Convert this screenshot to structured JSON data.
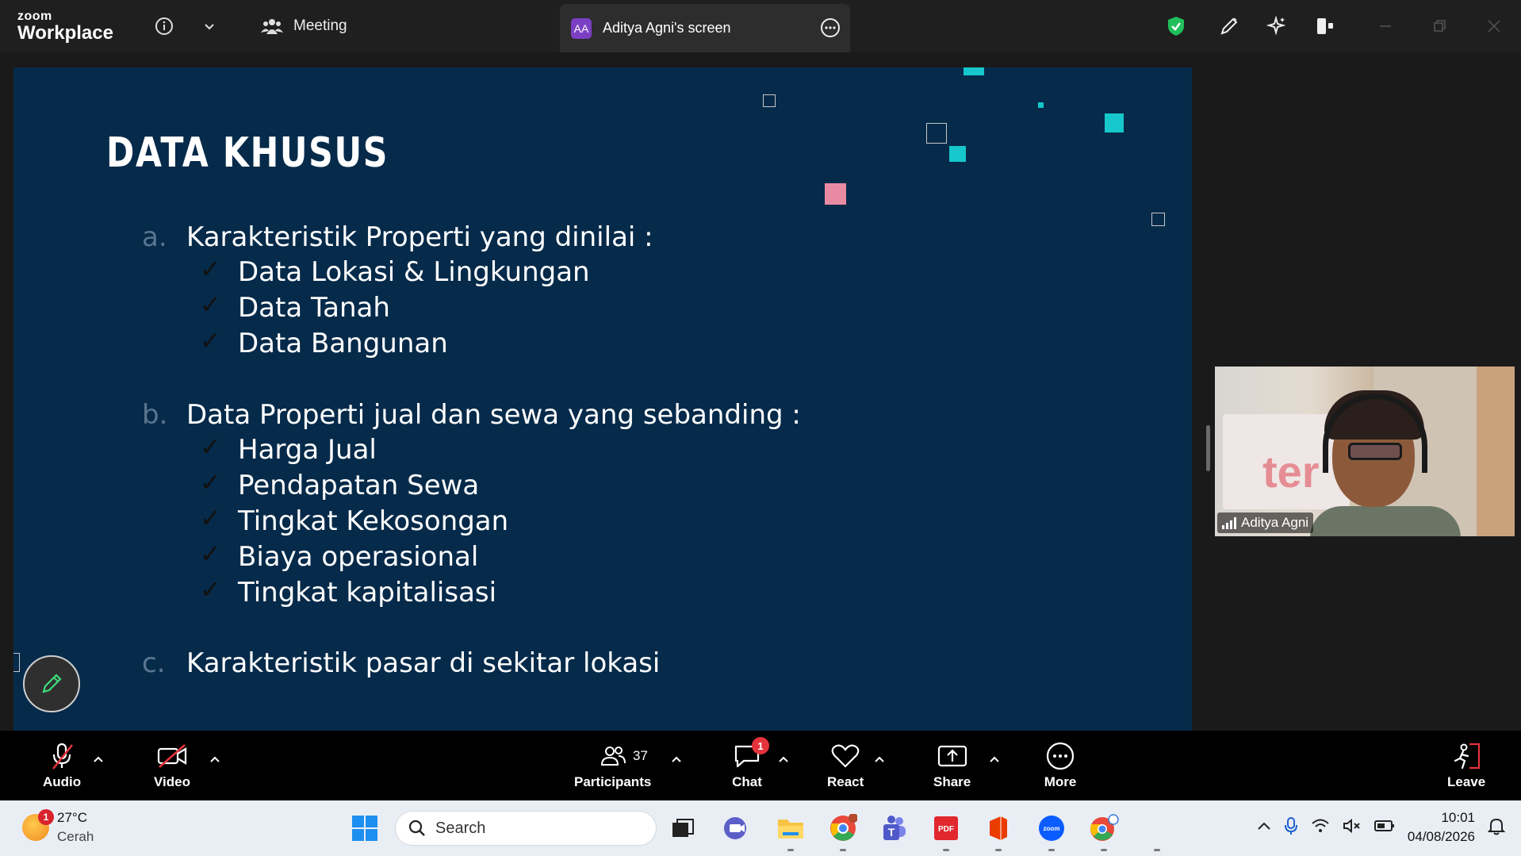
{
  "titlebar": {
    "logo_small": "zoom",
    "logo_big": "Workplace",
    "meeting_label": "Meeting",
    "share_avatar": "AA",
    "share_label": "Aditya Agni's screen"
  },
  "slide": {
    "title": "DATA KHUSUS",
    "sections": [
      {
        "letter": "a.",
        "heading": "Karakteristik Properti yang dinilai :",
        "items": [
          "Data Lokasi & Lingkungan",
          "Data Tanah",
          "Data Bangunan"
        ]
      },
      {
        "letter": "b.",
        "heading": "Data Properti jual dan sewa yang sebanding :",
        "items": [
          "Harga Jual",
          "Pendapatan Sewa",
          "Tingkat Kekosongan",
          "Biaya operasional",
          "Tingkat kapitalisasi"
        ]
      },
      {
        "letter": "c.",
        "heading": "Karakteristik pasar di sekitar lokasi",
        "items": []
      }
    ],
    "check_glyph": "✓",
    "colors": {
      "background": "#062a4a",
      "accent_teal": "#16c8cc",
      "accent_pink": "#e98aa3"
    }
  },
  "video": {
    "name": "Aditya Agni",
    "poster_text": "ter"
  },
  "toolbar": {
    "audio": "Audio",
    "video": "Video",
    "participants": "Participants",
    "participants_count": "37",
    "chat": "Chat",
    "chat_badge": "1",
    "react": "React",
    "share": "Share",
    "more": "More",
    "leave": "Leave"
  },
  "taskbar": {
    "weather_badge": "1",
    "temp": "27°C",
    "condition": "Cerah",
    "search_placeholder": "Search",
    "time": "10:01",
    "date": "04/08/2026"
  }
}
